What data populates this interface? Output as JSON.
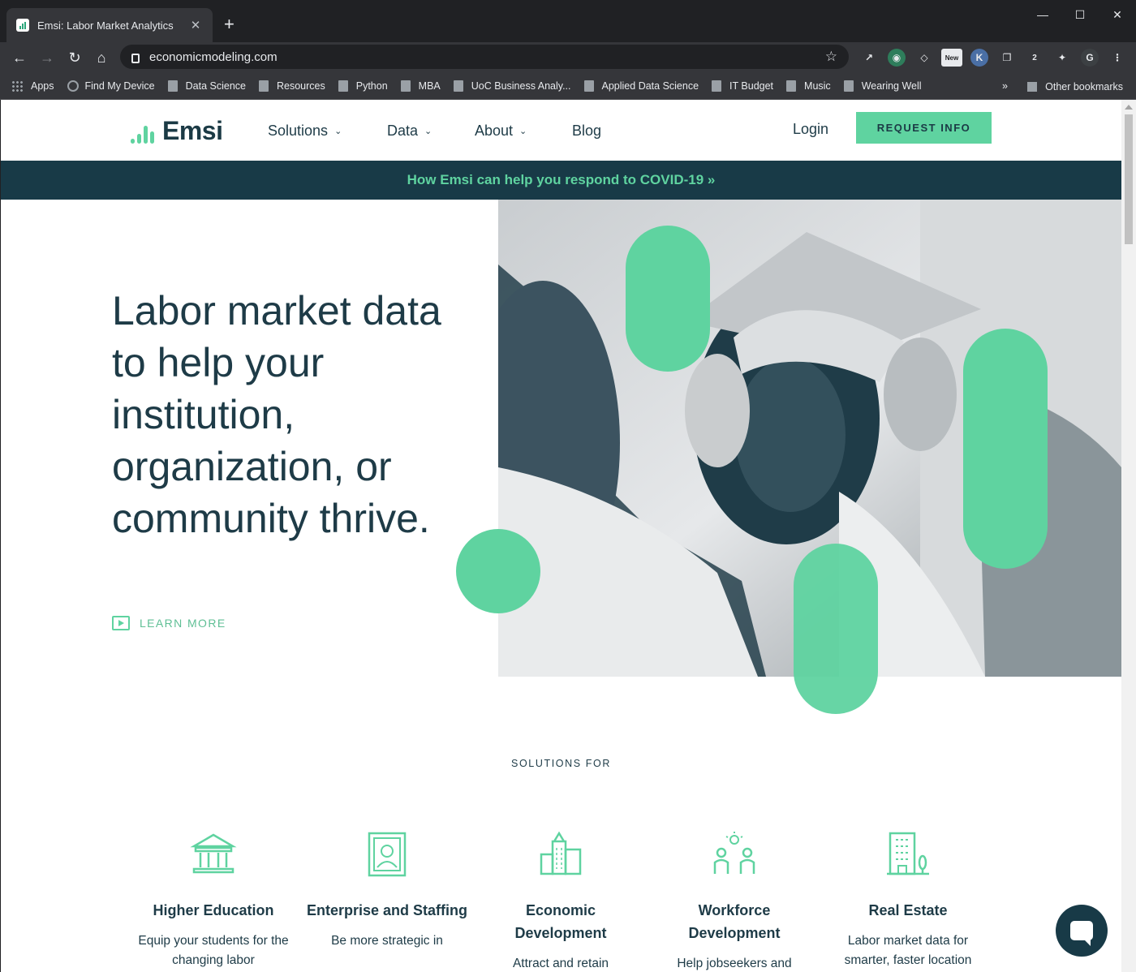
{
  "browser": {
    "tab_title": "Emsi: Labor Market Analytics",
    "new_tab": "+",
    "url": "economicmodeling.com",
    "window_controls": {
      "minimize": "—",
      "maximize": "☐",
      "close": "✕"
    },
    "extensions": {
      "badge_new": "New",
      "k_label": "K",
      "count_badge": "2",
      "profile_initial": "G"
    },
    "bookmarks": [
      "Apps",
      "Find My Device",
      "Data Science",
      "Resources",
      "Python",
      "MBA",
      "UoC Business Analy...",
      "Applied Data Science",
      "IT Budget",
      "Music",
      "Wearing Well"
    ],
    "more_bookmarks": "»",
    "other_bookmarks": "Other bookmarks"
  },
  "site": {
    "logo_text": "Emsi",
    "nav": {
      "solutions": "Solutions",
      "data": "Data",
      "about": "About",
      "blog": "Blog",
      "login": "Login",
      "request_info": "REQUEST INFO"
    },
    "banner": "How Emsi can help you respond to COVID-19 »",
    "hero": {
      "headline": "Labor market data to help your institution, organization, or community thrive.",
      "learn_more": "LEARN MORE"
    },
    "solutions_label": "SOLUTIONS FOR",
    "solutions": [
      {
        "title": "Higher Education",
        "text": "Equip your students for the changing labor"
      },
      {
        "title": "Enterprise and Staffing",
        "text": "Be more strategic in"
      },
      {
        "title": "Economic Development",
        "text": "Attract and retain"
      },
      {
        "title": "Workforce Development",
        "text": "Help jobseekers and"
      },
      {
        "title": "Real Estate",
        "text": "Labor market data for smarter, faster location"
      }
    ]
  },
  "colors": {
    "brand_dark": "#1b3a45",
    "accent_green": "#5fd3a0",
    "banner_bg": "#183a47"
  }
}
